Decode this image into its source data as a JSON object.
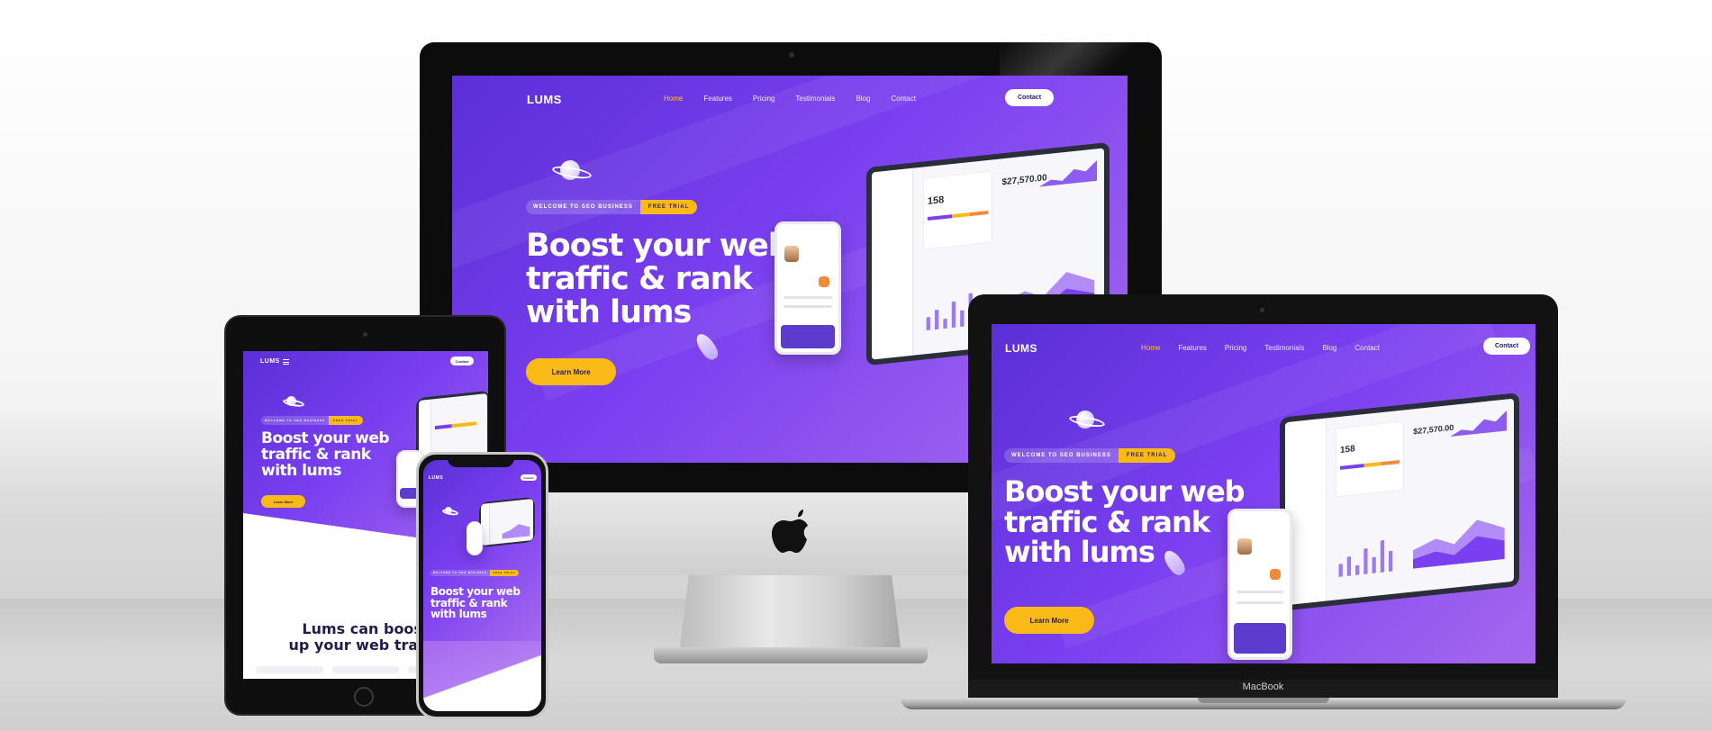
{
  "site": {
    "logo": "LUMS",
    "nav": [
      "Home",
      "Features",
      "Pricing",
      "Testimonials",
      "Blog",
      "Contact"
    ],
    "contact_button": "Contact",
    "badge_welcome": "WELCOME TO SEO BUSINESS",
    "badge_trial": "FREE TRIAL",
    "headline_line1": "Boost your web",
    "headline_line2": "traffic & rank",
    "headline_line3": "with lums",
    "learn_more": "Learn More",
    "dashboard_price": "$27,570.00",
    "dashboard_count": "158"
  },
  "ipad_lower": {
    "heading_line1": "Lums can boost",
    "heading_line2": "up your web traffic"
  },
  "macbook_label": "MacBook",
  "colors": {
    "purple_start": "#5b2fd6",
    "purple_end": "#a569ee",
    "accent_yellow": "#f9b916",
    "nav_active": "#ffc33a"
  }
}
